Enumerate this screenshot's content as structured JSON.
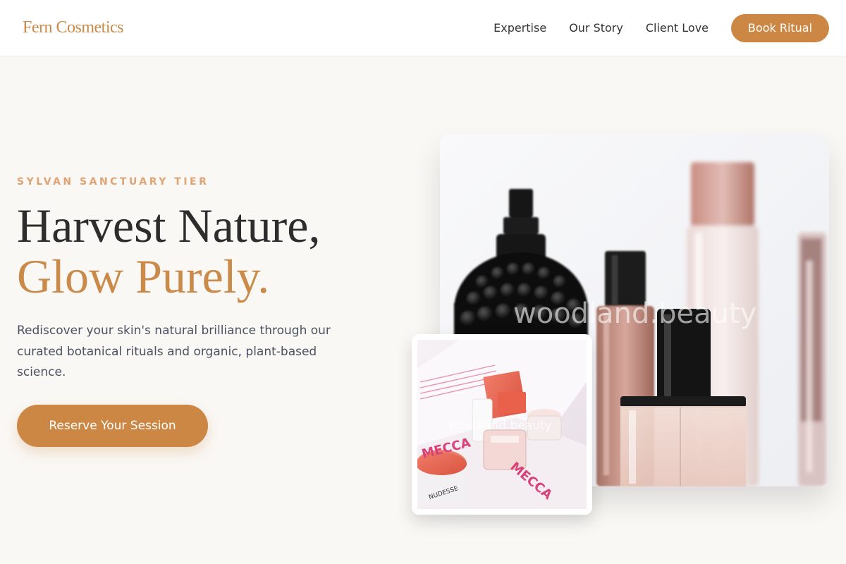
{
  "header": {
    "brand": "Fern Cosmetics",
    "nav": [
      {
        "label": "Expertise"
      },
      {
        "label": "Our Story"
      },
      {
        "label": "Client Love"
      }
    ],
    "cta_label": "Book Ritual"
  },
  "hero": {
    "eyebrow": "SYLVAN SANCTUARY TIER",
    "headline_line1": "Harvest Nature,",
    "headline_line2": "Glow Purely.",
    "lede": "Rediscover your skin's natural brilliance through our curated botanical rituals and organic, plant-based science.",
    "cta_label": "Reserve Your Session"
  },
  "images": {
    "main_watermark": "woodland.beauty",
    "secondary_watermark": "woodland.beauty",
    "secondary_label_1": "MECCA",
    "secondary_label_2": "NUDESSE"
  },
  "colors": {
    "accent": "#cd8745",
    "eyebrow": "#e0a373",
    "background": "#faf8f5",
    "text_dark": "#2d2d2d",
    "text_body": "#4a5160"
  }
}
